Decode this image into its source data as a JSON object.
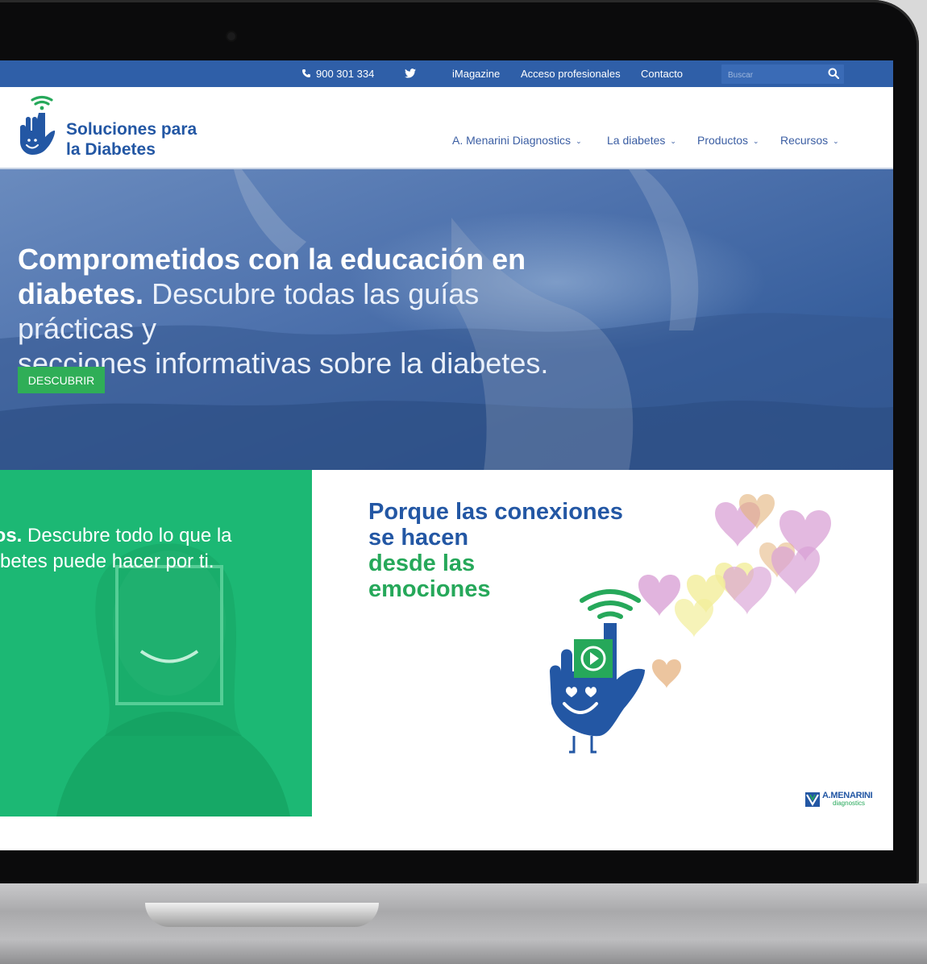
{
  "topbar": {
    "phone": "900 301 334",
    "links": [
      "iMagazine",
      "Acceso profesionales",
      "Contacto"
    ],
    "search_placeholder": "Buscar"
  },
  "brand": {
    "line1": "Soluciones para",
    "line2": "la Diabetes"
  },
  "nav": {
    "items": [
      {
        "label": "A. Menarini Diagnostics"
      },
      {
        "label": "La diabetes"
      },
      {
        "label": "Productos"
      },
      {
        "label": "Recursos"
      }
    ]
  },
  "hero": {
    "title_bold_1": "Comprometidos con la educación en",
    "title_bold_2": "diabetes.",
    "title_light_1": "Descubre todas las guías prácticas y",
    "title_light_2": "secciones informativas sobre la diabetes.",
    "cta": "DESCUBRIR"
  },
  "green_panel": {
    "bold": "los.",
    "light_1": "Descubre todo lo que la",
    "light_2": "betes puede hacer por ti."
  },
  "promo": {
    "line1": "Porque las conexiones",
    "line2": "se hacen",
    "line3": "desde las",
    "line4": "emociones"
  },
  "partner_logo": {
    "name": "A.MENARINI",
    "sub": "diagnostics"
  },
  "colors": {
    "topbar": "#2f5fa8",
    "brand_blue": "#2357a4",
    "green_cta": "#2fae57",
    "green_panel": "#1cb874"
  }
}
